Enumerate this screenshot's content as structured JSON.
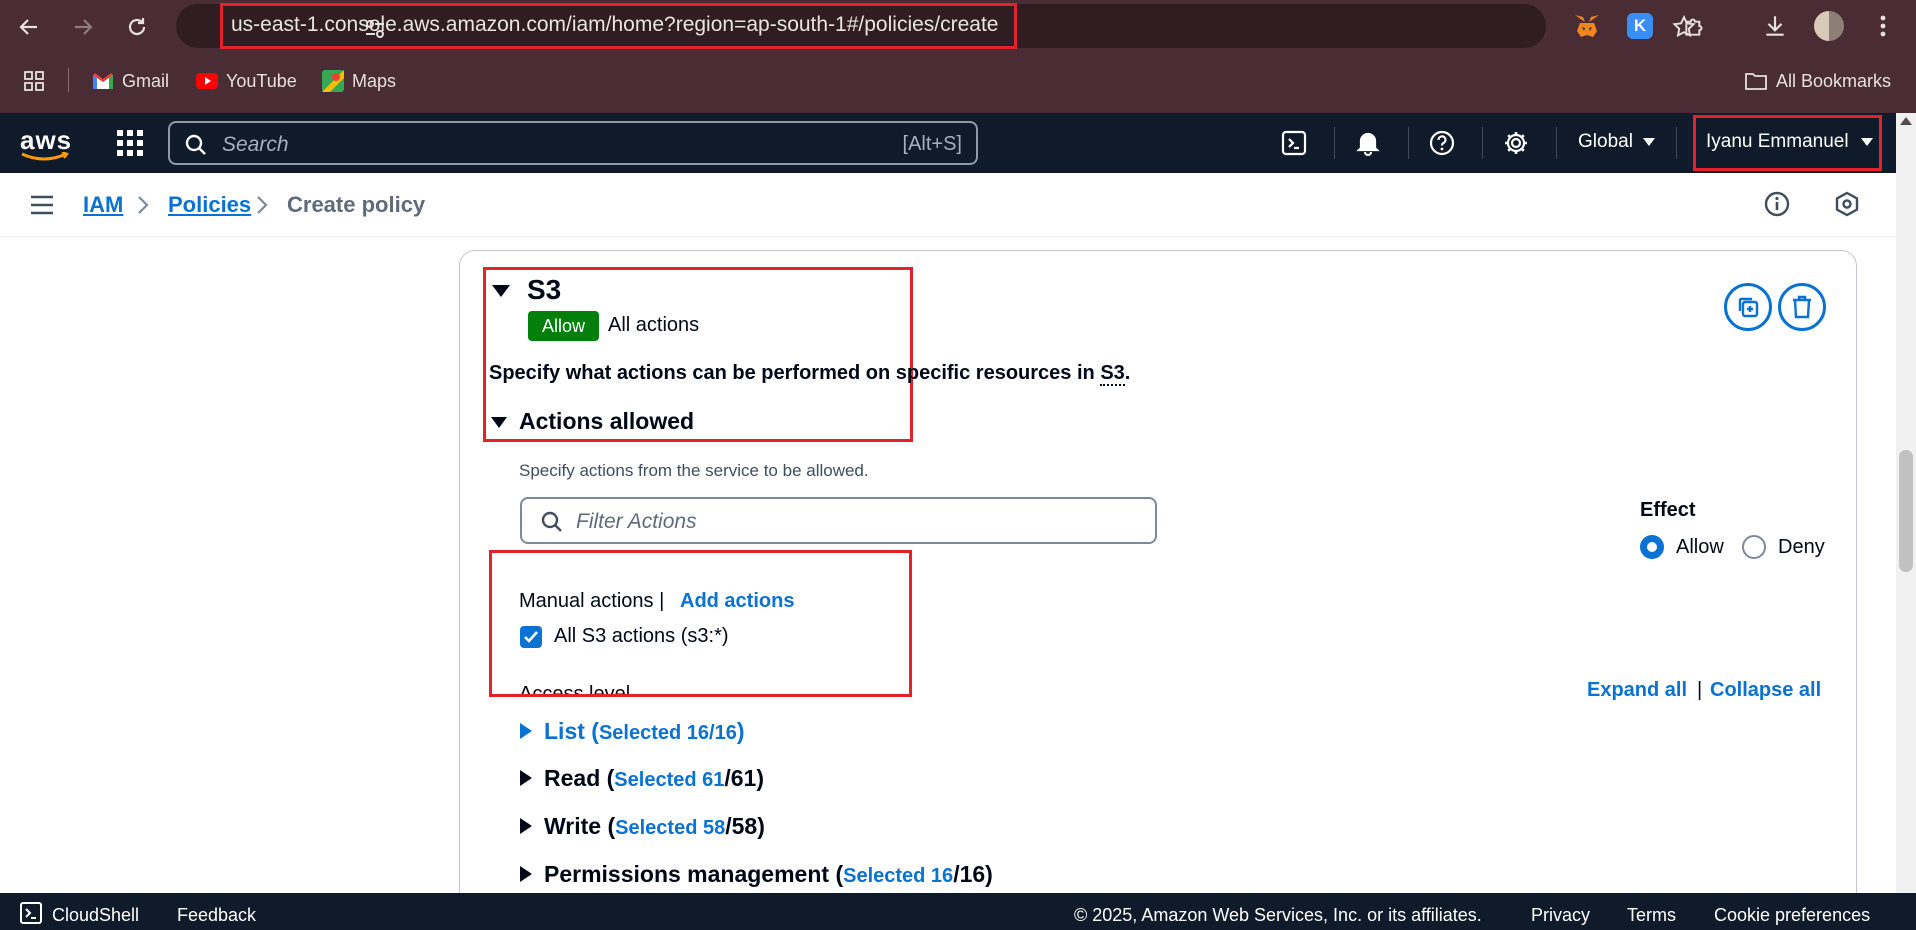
{
  "browser": {
    "url": "us-east-1.console.aws.amazon.com/iam/home?region=ap-south-1#/policies/create",
    "bookmarks": [
      "Gmail",
      "YouTube",
      "Maps"
    ],
    "all_bookmarks": "All Bookmarks",
    "extension_k_label": "K"
  },
  "aws_header": {
    "logo": "aws",
    "search_placeholder": "Search",
    "search_shortcut": "[Alt+S]",
    "region": "Global",
    "user": "Iyanu Emmanuel"
  },
  "breadcrumb": [
    "IAM",
    "Policies",
    "Create policy"
  ],
  "service": {
    "name": "S3",
    "effect_badge": "Allow",
    "summary": "All actions",
    "description": "Specify what actions can be performed on specific resources in",
    "description_service": "S3",
    "description_end": ".",
    "actions_allowed_heading": "Actions allowed",
    "actions_hint": "Specify actions from the service to be allowed.",
    "filter_placeholder": "Filter Actions",
    "effect_label": "Effect",
    "effect_options": [
      "Allow",
      "Deny"
    ],
    "effect_selected": "Allow",
    "manual_actions": "Manual actions |",
    "add_actions": "Add actions",
    "all_actions_checkbox": "All S3 actions (s3:*)",
    "all_actions_checked": true,
    "access_level": "Access level",
    "expand_all": "Expand all",
    "separator": "|",
    "collapse_all": "Collapse all",
    "levels": [
      {
        "name": "List (",
        "selected": "Selected 16/16",
        "rest": ")"
      },
      {
        "name": "Read (",
        "selected": "Selected 61",
        "rest": "/61)"
      },
      {
        "name": "Write (",
        "selected": "Selected 58",
        "rest": "/58)"
      },
      {
        "name": "Permissions management (",
        "selected": "Selected 16",
        "rest": "/16)"
      }
    ]
  },
  "footer": {
    "cloudshell": "CloudShell",
    "feedback": "Feedback",
    "copyright": "© 2025, Amazon Web Services, Inc. or its affiliates.",
    "privacy": "Privacy",
    "terms": "Terms",
    "cookies": "Cookie preferences"
  },
  "colors": {
    "browser_frame": "#4a2c34",
    "aws_nav": "#0f1b2a",
    "link_blue": "#0972d3",
    "allow_green": "#037f0c",
    "highlight_red": "#e3222a"
  }
}
